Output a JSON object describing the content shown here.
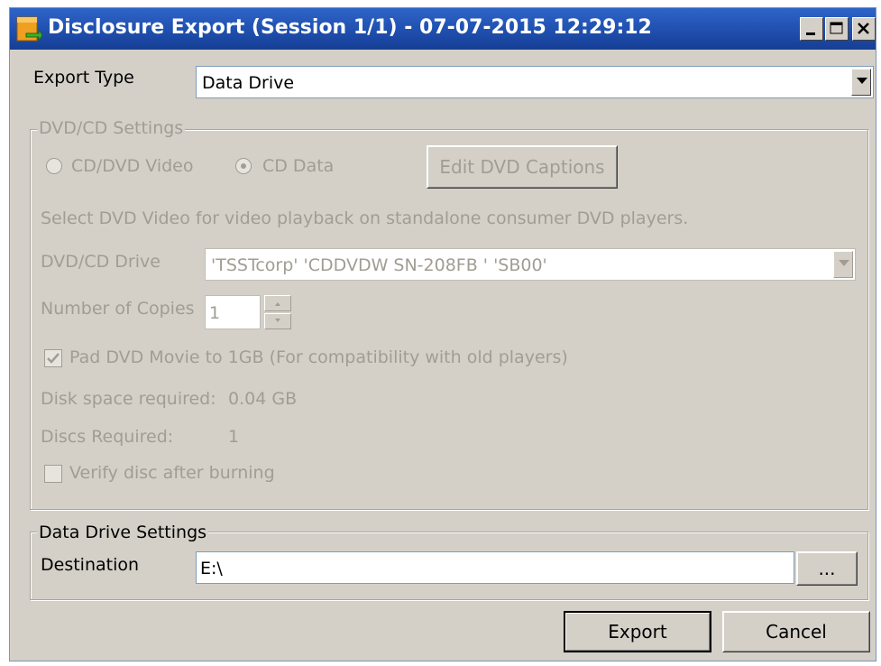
{
  "window": {
    "title": "Disclosure Export (Session 1/1) - 07-07-2015 12:29:12",
    "controls": {
      "minimize": "_",
      "maximize": "□",
      "close": "X"
    }
  },
  "export_type": {
    "label": "Export Type",
    "value": "Data Drive"
  },
  "dvd_settings": {
    "legend": "DVD/CD Settings",
    "radio_video": {
      "label": "CD/DVD Video",
      "selected": false
    },
    "radio_data": {
      "label": "CD Data",
      "selected": true
    },
    "edit_captions_label": "Edit DVD Captions",
    "hint": "Select DVD Video for video playback on standalone consumer DVD players.",
    "drive_label": "DVD/CD Drive",
    "drive_value": "'TSSTcorp' 'CDDVDW SN-208FB ' 'SB00'",
    "copies_label": "Number of Copies",
    "copies_value": "1",
    "pad_label": "Pad DVD Movie to 1GB (For compatibility with old players)",
    "pad_checked": true,
    "space_label": "Disk space required:",
    "space_value": "0.04 GB",
    "discs_label": "Discs Required:",
    "discs_value": "1",
    "verify_label": "Verify disc after burning",
    "verify_checked": false
  },
  "data_drive": {
    "legend": "Data Drive Settings",
    "destination_label": "Destination",
    "destination_value": "E:\\",
    "browse_label": "..."
  },
  "buttons": {
    "export": "Export",
    "cancel": "Cancel"
  },
  "icons": [
    "app-icon",
    "minimize-icon",
    "maximize-icon",
    "close-icon",
    "dropdown-arrow-icon",
    "spin-up-icon",
    "spin-down-icon",
    "checkmark-icon"
  ]
}
